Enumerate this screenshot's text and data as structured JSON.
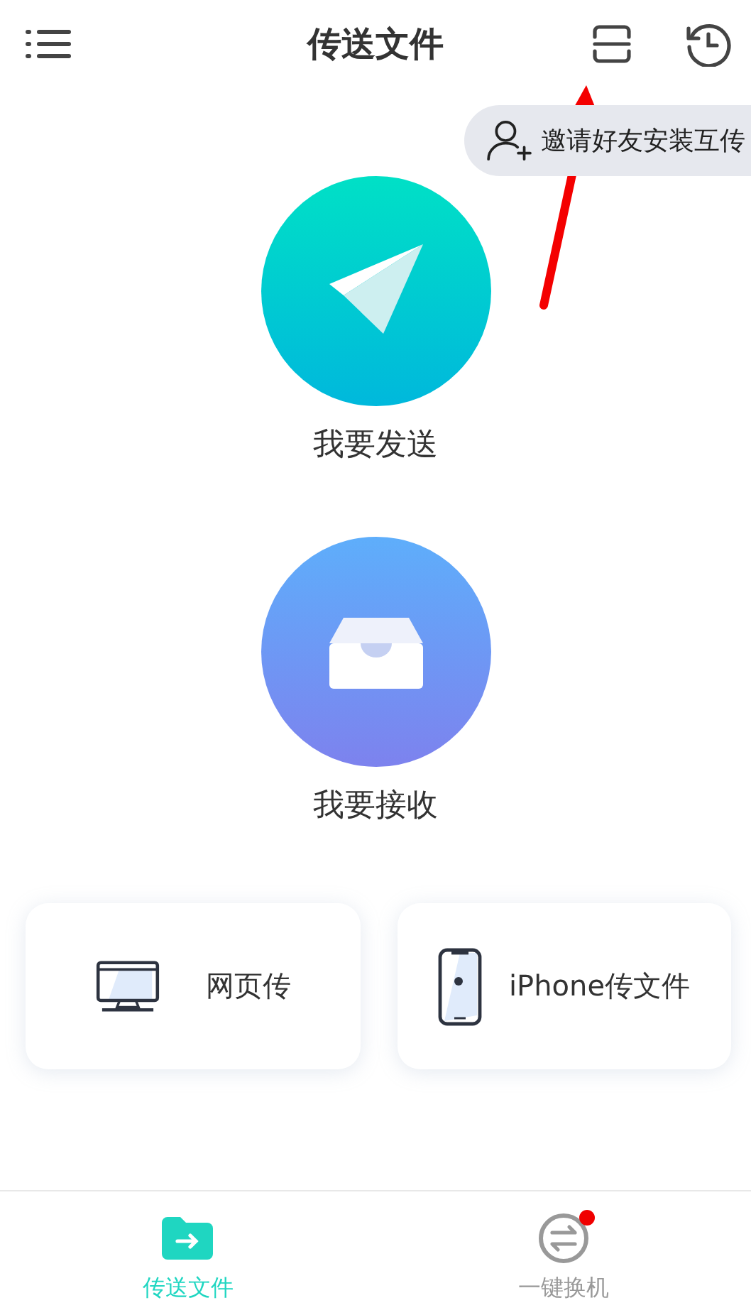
{
  "header": {
    "title": "传送文件"
  },
  "invite": {
    "label": "邀请好友安装互传"
  },
  "actions": [
    {
      "kind": "send",
      "label": "我要发送"
    },
    {
      "kind": "receive",
      "label": "我要接收"
    }
  ],
  "cards": [
    {
      "kind": "web",
      "label": "网页传"
    },
    {
      "kind": "iphone",
      "label": "iPhone传文件"
    }
  ],
  "tabs": [
    {
      "kind": "transfer",
      "label": "传送文件",
      "selected": true,
      "badge": false
    },
    {
      "kind": "switch",
      "label": "一键换机",
      "selected": false,
      "badge": true
    }
  ]
}
